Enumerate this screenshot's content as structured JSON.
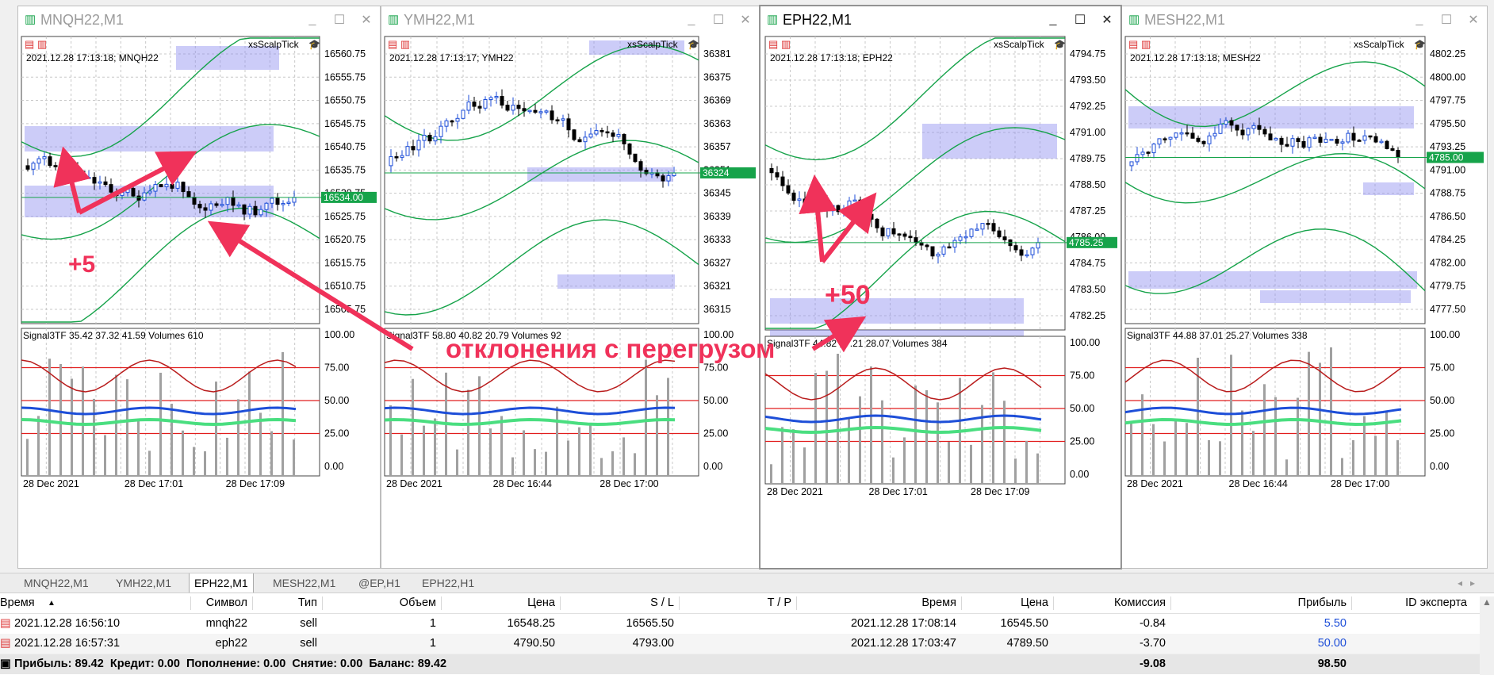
{
  "colors": {
    "bull_candle": "#1d4ed8",
    "bear_candle": "#000000",
    "band": "#16a34a",
    "zone": "#8f8ff0",
    "volume_bar": "#a0a0a0",
    "level_line": "#e11d1d",
    "annotation": "#f0325a",
    "price_tag": "#16a34a",
    "profit_blue": "#1d4ed8"
  },
  "windows": [
    {
      "title": "MNQH22,M1",
      "icon": "chart-icon",
      "indicator": "xsScalpTick",
      "info": "2021.12.28 17:13:18; MNQH22",
      "price_labels": [
        "16560.75",
        "16555.75",
        "16550.75",
        "16545.75",
        "16540.75",
        "16535.75",
        "16530.75",
        "16525.75",
        "16520.75",
        "16515.75",
        "16510.75",
        "16505.75"
      ],
      "current_price": "16534.00",
      "signal_text": "Signal3TF 35.42 37.32 41.59 Volumes 610",
      "osc_labels": [
        "100.00",
        "75.00",
        "50.00",
        "25.00",
        "0.00"
      ],
      "time_labels": [
        "28 Dec 2021",
        "28 Dec 17:01",
        "28 Dec 17:09"
      ]
    },
    {
      "title": "YMH22,M1",
      "icon": "chart-icon",
      "indicator": "xsScalpTick",
      "info": "2021.12.28 17:13:17; YMH22",
      "price_labels": [
        "36381",
        "36375",
        "36369",
        "36363",
        "36357",
        "36351",
        "36345",
        "36339",
        "36333",
        "36327",
        "36321",
        "36315"
      ],
      "current_price": "36324",
      "signal_text": "Signal3TF 58.80 40.82 20.79 Volumes 92",
      "osc_labels": [
        "100.00",
        "75.00",
        "50.00",
        "25.00",
        "0.00"
      ],
      "time_labels": [
        "28 Dec 2021",
        "28 Dec 16:44",
        "28 Dec 17:00"
      ]
    },
    {
      "title": "EPH22,M1",
      "icon": "chart-icon",
      "indicator": "xsScalpTick",
      "info": "2021.12.28 17:13:18; EPH22",
      "price_labels": [
        "4794.75",
        "4793.50",
        "4792.25",
        "4791.00",
        "4789.75",
        "4788.50",
        "4787.25",
        "4786.00",
        "4784.75",
        "4783.50",
        "4782.25"
      ],
      "current_price": "4785.25",
      "signal_text": "Signal3TF 44.82 37.21 28.07 Volumes 384",
      "osc_labels": [
        "100.00",
        "75.00",
        "50.00",
        "25.00",
        "0.00"
      ],
      "time_labels": [
        "28 Dec 2021",
        "28 Dec 17:01",
        "28 Dec 17:09"
      ]
    },
    {
      "title": "MESH22,M1",
      "icon": "chart-icon",
      "indicator": "xsScalpTick",
      "info": "2021.12.28 17:13:18; MESH22",
      "price_labels": [
        "4802.25",
        "4800.00",
        "4797.75",
        "4795.50",
        "4793.25",
        "4791.00",
        "4788.75",
        "4786.50",
        "4784.25",
        "4782.00",
        "4779.75",
        "4777.50"
      ],
      "current_price": "4785.00",
      "signal_text": "Signal3TF 44.88 37.01 25.27 Volumes 338",
      "osc_labels": [
        "100.00",
        "75.00",
        "50.00",
        "25.00",
        "0.00"
      ],
      "time_labels": [
        "28 Dec 2021",
        "28 Dec 16:44",
        "28 Dec 17:00"
      ]
    }
  ],
  "annotations": {
    "plus5": "+5",
    "plus50": "+50",
    "deviation": "отклонения с перегрузом"
  },
  "tabs": [
    "MNQH22,M1",
    "YMH22,M1",
    "EPH22,M1",
    "MESH22,M1",
    "@EP,H1",
    "EPH22,H1"
  ],
  "selected_tab": "EPH22,M1",
  "table": {
    "headers": [
      "Время",
      "Символ",
      "Тип",
      "Объем",
      "Цена",
      "S / L",
      "T / P",
      "Время",
      "Цена",
      "Комиссия",
      "Прибыль",
      "ID эксперта"
    ],
    "rows": [
      {
        "open_time": "2021.12.28 16:56:10",
        "symbol": "mnqh22",
        "type": "sell",
        "volume": "1",
        "price": "16548.25",
        "sl": "16565.50",
        "tp": "",
        "close_time": "2021.12.28 17:08:14",
        "close_price": "16545.50",
        "commission": "-0.84",
        "profit": "5.50",
        "expert_id": ""
      },
      {
        "open_time": "2021.12.28 16:57:31",
        "symbol": "eph22",
        "type": "sell",
        "volume": "1",
        "price": "4790.50",
        "sl": "4793.00",
        "tp": "",
        "close_time": "2021.12.28 17:03:47",
        "close_price": "4789.50",
        "commission": "-3.70",
        "profit": "50.00",
        "expert_id": ""
      }
    ],
    "summary": "Прибыль: 89.42  Кредит: 0.00  Пополнение: 0.00  Снятие: 0.00  Баланс: 89.42",
    "total_commission": "-9.08",
    "total_profit": "98.50"
  }
}
